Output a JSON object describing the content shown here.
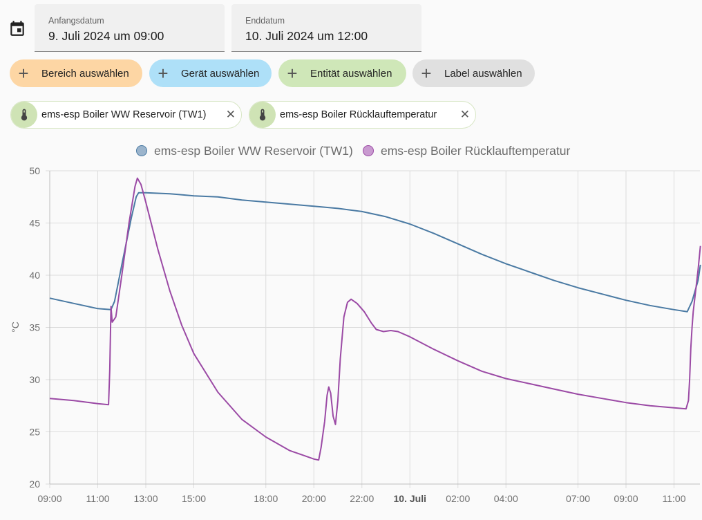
{
  "date_range": {
    "start_label": "Anfangsdatum",
    "start_value": "9. Juli 2024 um 09:00",
    "end_label": "Enddatum",
    "end_value": "10. Juli 2024 um 12:00",
    "calendar_icon": "calendar-icon"
  },
  "pickers": [
    {
      "label": "Bereich auswählen",
      "color": "#fdd6a4"
    },
    {
      "label": "Gerät auswählen",
      "color": "#aee0f8"
    },
    {
      "label": "Entität auswählen",
      "color": "#cfe7b8"
    },
    {
      "label": "Label auswählen",
      "color": "#e0e0e0"
    }
  ],
  "selected_entities": [
    {
      "label": "ems-esp Boiler WW Reservoir (TW1)",
      "icon": "thermometer-icon"
    },
    {
      "label": "ems-esp Boiler Rücklauftemperatur",
      "icon": "thermometer-icon"
    }
  ],
  "chart_data": {
    "type": "line",
    "ylabel": "°C",
    "ylim": [
      20,
      50
    ],
    "yticks": [
      20,
      25,
      30,
      35,
      40,
      45,
      50
    ],
    "xlim": [
      "09:00",
      "12:20 (+1)"
    ],
    "xticks": [
      {
        "label": "09:00",
        "h": 0
      },
      {
        "label": "11:00",
        "h": 2
      },
      {
        "label": "13:00",
        "h": 4
      },
      {
        "label": "15:00",
        "h": 6
      },
      {
        "label": "18:00",
        "h": 9
      },
      {
        "label": "20:00",
        "h": 11
      },
      {
        "label": "22:00",
        "h": 13
      },
      {
        "label": "10. Juli",
        "h": 15,
        "bold": true
      },
      {
        "label": "02:00",
        "h": 17
      },
      {
        "label": "04:00",
        "h": 19
      },
      {
        "label": "07:00",
        "h": 22
      },
      {
        "label": "09:00",
        "h": 24
      },
      {
        "label": "11:00",
        "h": 26
      }
    ],
    "grid": true,
    "legend_position": "top",
    "series": [
      {
        "name": "ems-esp Boiler WW Reservoir (TW1)",
        "color": "#4a7aa3",
        "legend_fill": "#9bb4cc",
        "points": [
          [
            0,
            37.8
          ],
          [
            1,
            37.3
          ],
          [
            2,
            36.8
          ],
          [
            2.55,
            36.7
          ],
          [
            2.7,
            37.5
          ],
          [
            3.0,
            41
          ],
          [
            3.4,
            45.5
          ],
          [
            3.6,
            47.5
          ],
          [
            3.7,
            47.9
          ],
          [
            4,
            47.9
          ],
          [
            5,
            47.8
          ],
          [
            6,
            47.6
          ],
          [
            7,
            47.5
          ],
          [
            8,
            47.2
          ],
          [
            9,
            47.0
          ],
          [
            10,
            46.8
          ],
          [
            11,
            46.6
          ],
          [
            12,
            46.4
          ],
          [
            13,
            46.1
          ],
          [
            14,
            45.6
          ],
          [
            15,
            44.9
          ],
          [
            16,
            44.0
          ],
          [
            17,
            43.0
          ],
          [
            18,
            42.0
          ],
          [
            19,
            41.1
          ],
          [
            20,
            40.3
          ],
          [
            21,
            39.5
          ],
          [
            22,
            38.8
          ],
          [
            23,
            38.2
          ],
          [
            24,
            37.6
          ],
          [
            25,
            37.1
          ],
          [
            26,
            36.7
          ],
          [
            26.55,
            36.5
          ],
          [
            26.75,
            37.5
          ],
          [
            27.0,
            39.5
          ],
          [
            27.1,
            41.0
          ]
        ]
      },
      {
        "name": "ems-esp Boiler Rücklauftemperatur",
        "color": "#9b4aa5",
        "legend_fill": "#c99ad0",
        "points": [
          [
            0,
            28.2
          ],
          [
            1,
            28.0
          ],
          [
            2,
            27.7
          ],
          [
            2.45,
            27.6
          ],
          [
            2.5,
            31
          ],
          [
            2.55,
            37
          ],
          [
            2.6,
            35.5
          ],
          [
            2.75,
            36
          ],
          [
            3.0,
            40
          ],
          [
            3.3,
            45
          ],
          [
            3.55,
            48.5
          ],
          [
            3.65,
            49.3
          ],
          [
            3.8,
            48.7
          ],
          [
            4,
            47
          ],
          [
            4.5,
            42.5
          ],
          [
            5,
            38.5
          ],
          [
            5.5,
            35.2
          ],
          [
            6,
            32.5
          ],
          [
            7,
            28.8
          ],
          [
            8,
            26.2
          ],
          [
            9,
            24.5
          ],
          [
            10,
            23.2
          ],
          [
            10.5,
            22.8
          ],
          [
            11,
            22.4
          ],
          [
            11.2,
            22.3
          ],
          [
            11.3,
            23.5
          ],
          [
            11.45,
            26
          ],
          [
            11.55,
            28.5
          ],
          [
            11.62,
            29.3
          ],
          [
            11.7,
            28.7
          ],
          [
            11.8,
            26.5
          ],
          [
            11.9,
            25.7
          ],
          [
            12.0,
            28
          ],
          [
            12.1,
            32
          ],
          [
            12.25,
            36
          ],
          [
            12.4,
            37.4
          ],
          [
            12.55,
            37.7
          ],
          [
            12.8,
            37.3
          ],
          [
            13.1,
            36.5
          ],
          [
            13.4,
            35.4
          ],
          [
            13.6,
            34.8
          ],
          [
            13.9,
            34.6
          ],
          [
            14.2,
            34.7
          ],
          [
            14.5,
            34.6
          ],
          [
            15,
            34.1
          ],
          [
            16,
            32.9
          ],
          [
            17,
            31.8
          ],
          [
            18,
            30.8
          ],
          [
            19,
            30.1
          ],
          [
            20,
            29.6
          ],
          [
            21,
            29.1
          ],
          [
            22,
            28.6
          ],
          [
            23,
            28.2
          ],
          [
            24,
            27.8
          ],
          [
            25,
            27.5
          ],
          [
            26,
            27.3
          ],
          [
            26.5,
            27.2
          ],
          [
            26.6,
            28
          ],
          [
            26.65,
            30
          ],
          [
            26.7,
            33
          ],
          [
            26.75,
            35
          ],
          [
            26.8,
            36.5
          ],
          [
            26.9,
            38.5
          ],
          [
            27.0,
            40.5
          ],
          [
            27.1,
            42.8
          ]
        ]
      }
    ]
  }
}
